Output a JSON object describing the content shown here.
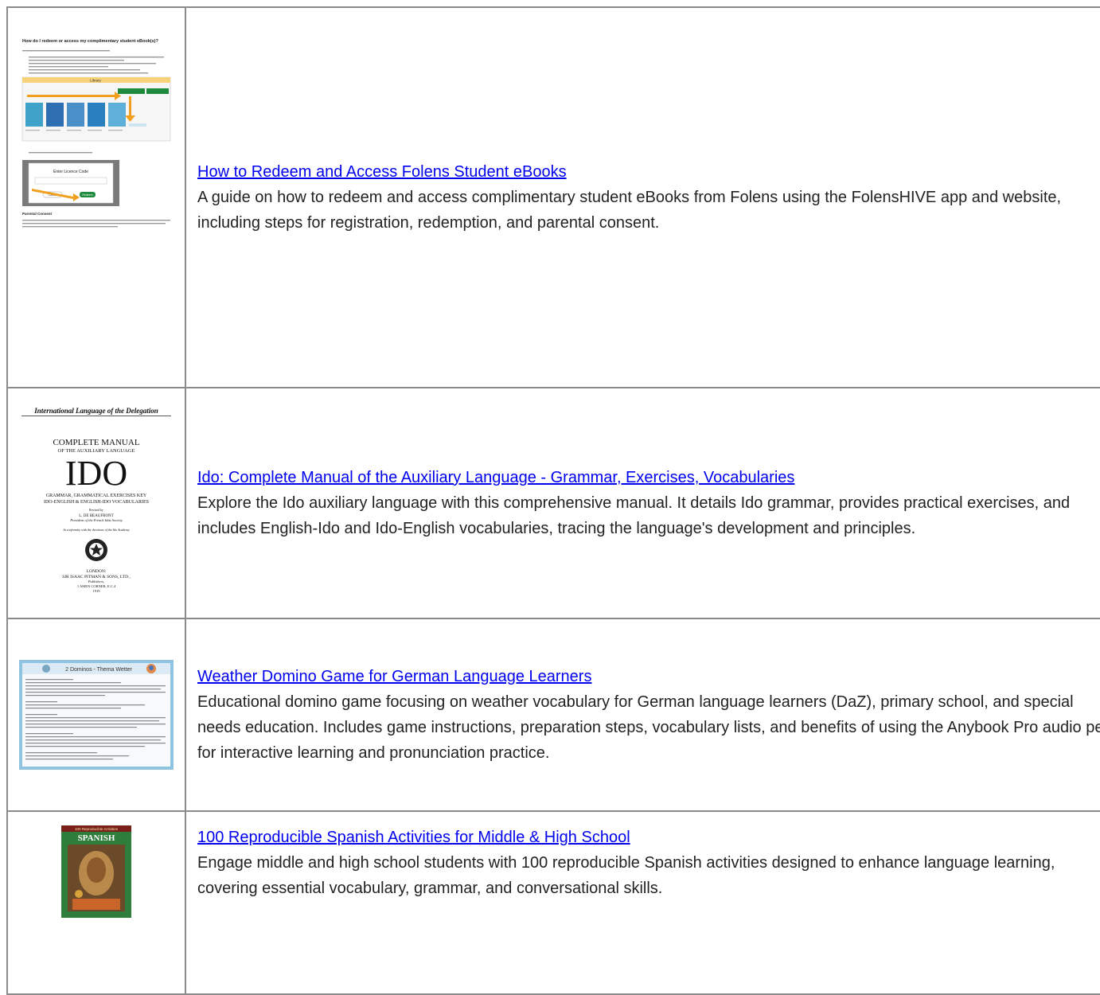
{
  "results": [
    {
      "title": "How to Redeem and Access Folens Student eBooks",
      "description": "A guide on how to redeem and access complimentary student eBooks from Folens using the FolensHIVE app and website, including steps for registration, redemption, and parental consent.",
      "thumb": {
        "heading": "How do I redeem or access my complimentary student eBook(s)?",
        "library_label": "Library",
        "license_label": "Enter Licence Code",
        "cancel_label": "Cancel",
        "redeem_label": "Redeem",
        "section_label": "Parental Consent",
        "tile_color": "#3fa2c8",
        "accent_color": "#f0a01e",
        "green_color": "#1e8a3c"
      }
    },
    {
      "title": "Ido: Complete Manual of the Auxiliary Language - Grammar, Exercises, Vocabularies",
      "description": "Explore the Ido auxiliary language with this comprehensive manual. It details Ido grammar, provides practical exercises, and includes English-Ido and Ido-English vocabularies, tracing the language's development and principles.",
      "thumb": {
        "header": "International Language of the Delegation",
        "line1": "COMPLETE MANUAL",
        "line2": "OF THE AUXILIARY LANGUAGE",
        "big": "IDO",
        "line3": "GRAMMAR, GRAMMATICAL EXERCISES KEY",
        "line4": "IDO-ENGLISH & ENGLISH-IDO VOCABULARIES",
        "line5": "Revised by",
        "line6": "L. DE BEAUFRONT",
        "line7": "President of the French Idist Society",
        "line8": "In conformity with the decisions of the Ido Academy",
        "line9": "LONDON:",
        "line10": "SIR ISAAC PITMAN & SONS, LTD.,",
        "line11": "Publishers,",
        "line12": "1 AMEN CORNER, E.C.4",
        "line13": "1919"
      }
    },
    {
      "title": "Weather Domino Game for German Language Learners",
      "description": "Educational domino game focusing on weather vocabulary for German language learners (DaZ), primary school, and special needs education. Includes game instructions, preparation steps, vocabulary lists, and benefits of using the Anybook Pro audio pen for interactive learning and pronunciation practice.",
      "thumb": {
        "heading": "2 Dominos - Thema Wetter",
        "frame_color": "#8fc4e0"
      }
    },
    {
      "title": "100 Reproducible Spanish Activities for Middle & High School",
      "description": "Engage middle and high school students with 100 reproducible Spanish activities designed to enhance language learning, covering essential vocabulary, grammar, and conversational skills.",
      "thumb": {
        "banner": "100 Reproducible Activities",
        "title": "SPANISH",
        "cover_color": "#2f7d3a"
      }
    }
  ]
}
